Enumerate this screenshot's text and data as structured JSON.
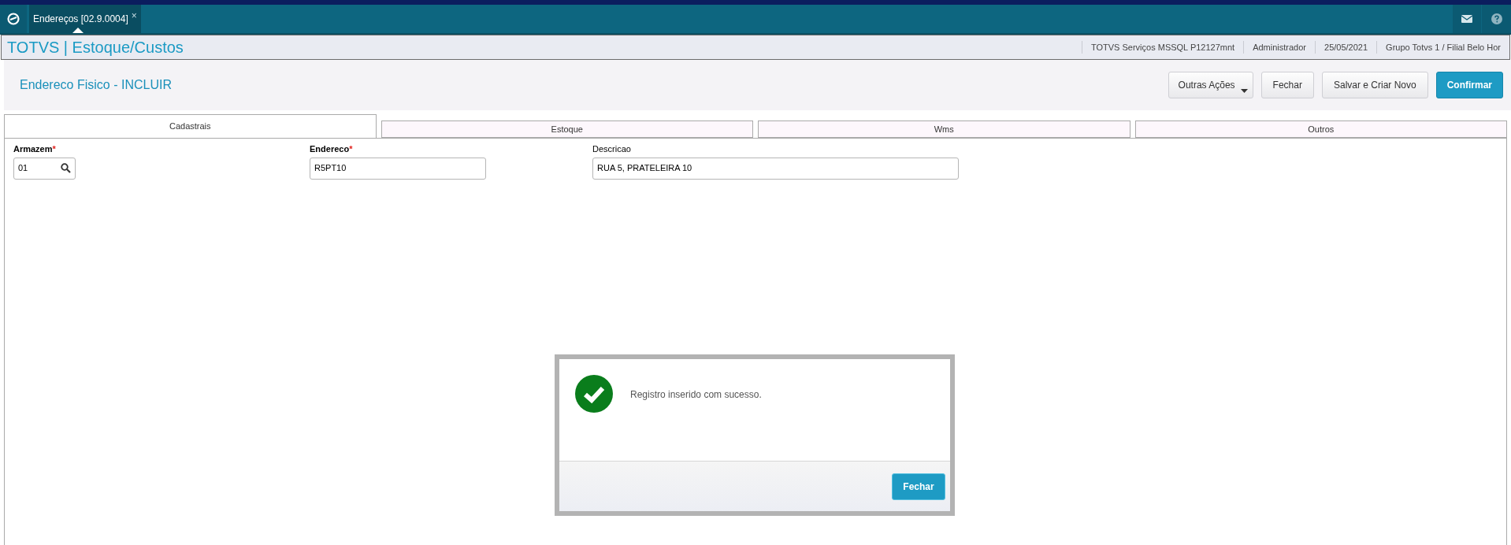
{
  "nav_tabs": [
    {
      "label": "Endereços [02.9.0004]",
      "close": "×",
      "selected": true
    }
  ],
  "header": {
    "title": "TOTVS | Estoque/Custos",
    "info": [
      "TOTVS Serviços MSSQL P12127mnt",
      "Administrador",
      "25/05/2021",
      "Grupo Totvs 1 / Filial Belo Hor"
    ]
  },
  "page": {
    "title": "Endereco Fisico - INCLUIR",
    "buttons": [
      {
        "label": "Outras Ações",
        "kind": "dropdown"
      },
      {
        "label": "Fechar",
        "kind": "plain"
      },
      {
        "label": "Salvar e Criar Novo",
        "kind": "plain"
      },
      {
        "label": "Confirmar",
        "kind": "primary"
      }
    ]
  },
  "tabs": [
    {
      "label": "Cadastrais",
      "selected": true
    },
    {
      "label": "Estoque",
      "selected": false
    },
    {
      "label": "Wms",
      "selected": false
    },
    {
      "label": "Outros",
      "selected": false
    }
  ],
  "fields": [
    {
      "label": "Armazem",
      "required": true,
      "required_mark": "*",
      "value": "01",
      "kind": "lookup"
    },
    {
      "label": "Endereco",
      "required": true,
      "required_mark": "*",
      "value": "R5PT10",
      "kind": "text"
    },
    {
      "label": "Descricao",
      "required": false,
      "value": "RUA 5, PRATELEIRA 10",
      "kind": "text"
    }
  ],
  "dialog": {
    "message": "Registro inserido com sucesso.",
    "button": "Fechar"
  }
}
